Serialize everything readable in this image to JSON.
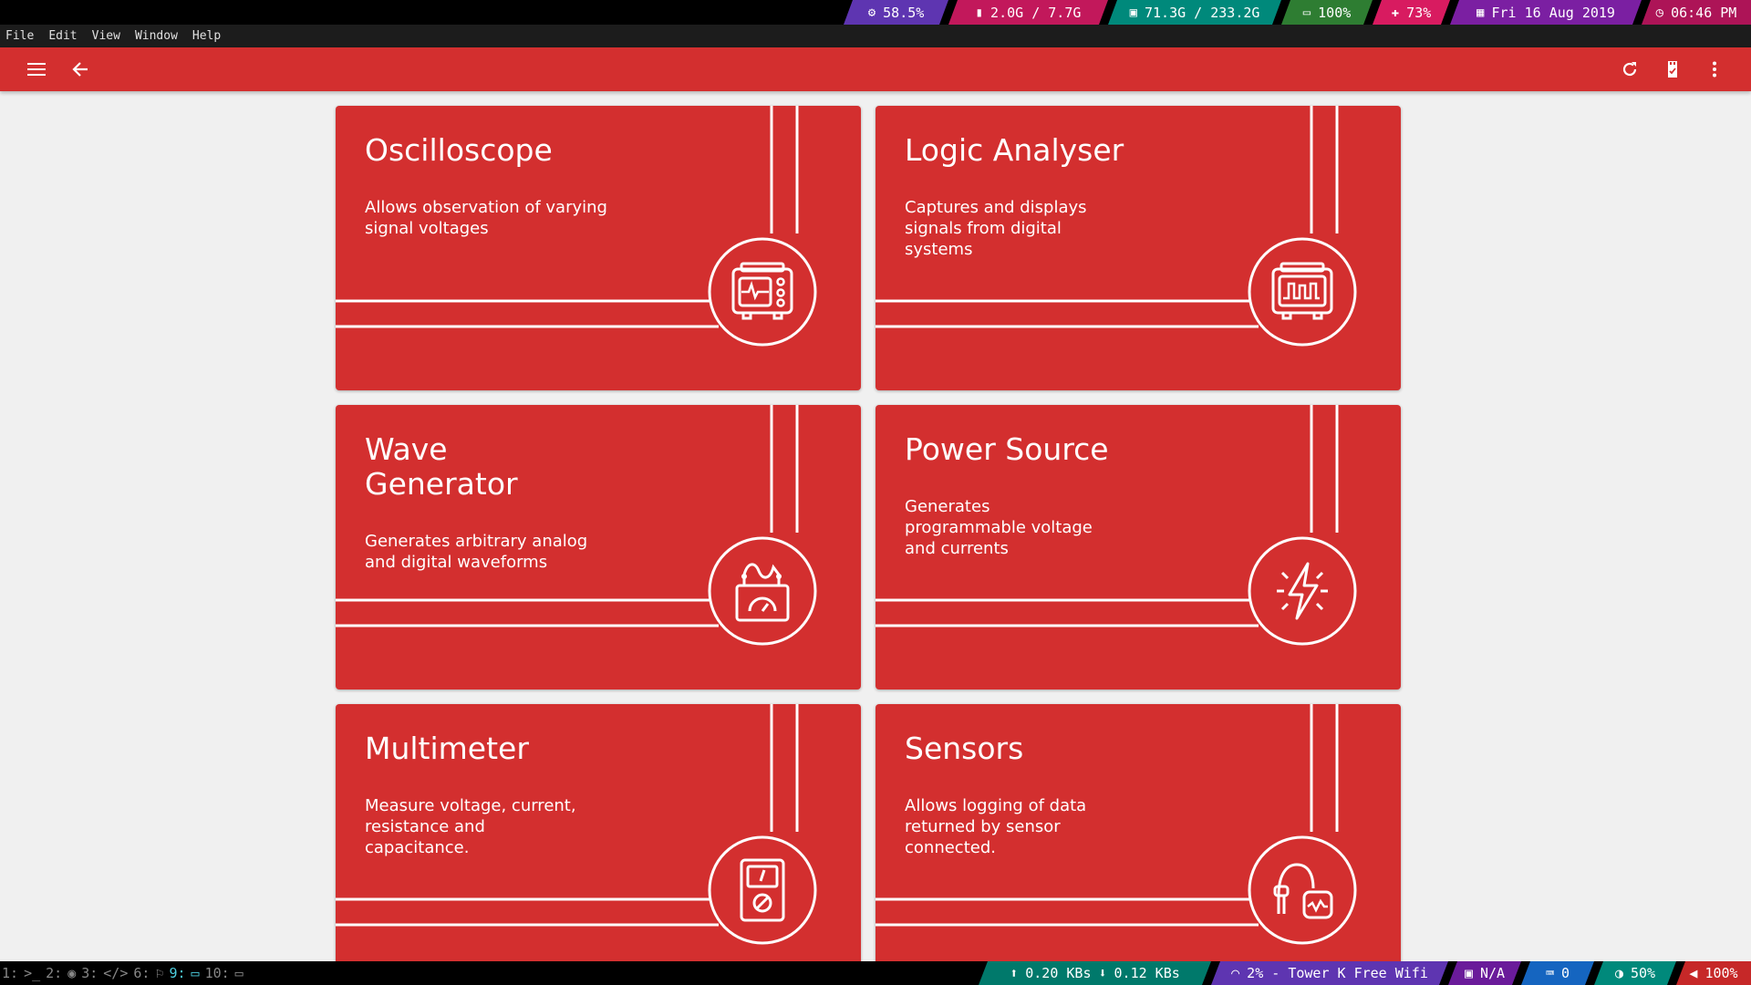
{
  "top_status": {
    "cpu": "58.5%",
    "memory": "2.0G / 7.7G",
    "disk": "71.3G / 233.2G",
    "battery": "100%",
    "brightness": "73%",
    "date": "Fri 16 Aug 2019",
    "time": "06:46 PM",
    "colors": {
      "cpu": "#5e35b1",
      "memory": "#c2185b",
      "disk": "#00897b",
      "battery": "#2e7d32",
      "brightness": "#d81b60",
      "date": "#7b1fa2",
      "time": "#ad1457"
    }
  },
  "menu": [
    "File",
    "Edit",
    "View",
    "Window",
    "Help"
  ],
  "toolbar": {
    "icons": [
      "hamburger-menu-icon",
      "back-arrow-icon",
      "refresh-icon",
      "usb-connected-icon",
      "more-vert-icon"
    ],
    "accent": "#d32f2f"
  },
  "cards": [
    {
      "title": "Oscilloscope",
      "description": "Allows observation of varying signal voltages",
      "icon": "oscilloscope-icon"
    },
    {
      "title": "Logic Analyser",
      "description": "Captures and displays signals from digital systems",
      "icon": "logic-analyser-icon"
    },
    {
      "title": "Wave Generator",
      "description": "Generates arbitrary analog and digital waveforms",
      "icon": "wave-generator-icon"
    },
    {
      "title": "Power Source",
      "description": "Generates programmable voltage and currents",
      "icon": "power-source-icon"
    },
    {
      "title": "Multimeter",
      "description": "Measure voltage, current, resistance and capacitance.",
      "icon": "multimeter-icon"
    },
    {
      "title": "Sensors",
      "description": "Allows logging of data returned by sensor connected.",
      "icon": "sensors-icon"
    }
  ],
  "bottom_status": {
    "workspaces": [
      "1:",
      "2:",
      "3:",
      "6:",
      "9:",
      "10:"
    ],
    "active_workspace": "9:",
    "net_up": "0.20 KBs",
    "net_down": "0.12 KBs",
    "wifi": "2% - Tower K Free Wifi",
    "vpn": "N/A",
    "keyboard": "0",
    "caffeine": "50%",
    "volume": "100%",
    "colors": {
      "net": "#00796b",
      "wifi": "#5e35b1",
      "vpn": "#6a1b9a",
      "keyboard": "#1565c0",
      "caffeine": "#00897b",
      "volume": "#c62828"
    }
  }
}
